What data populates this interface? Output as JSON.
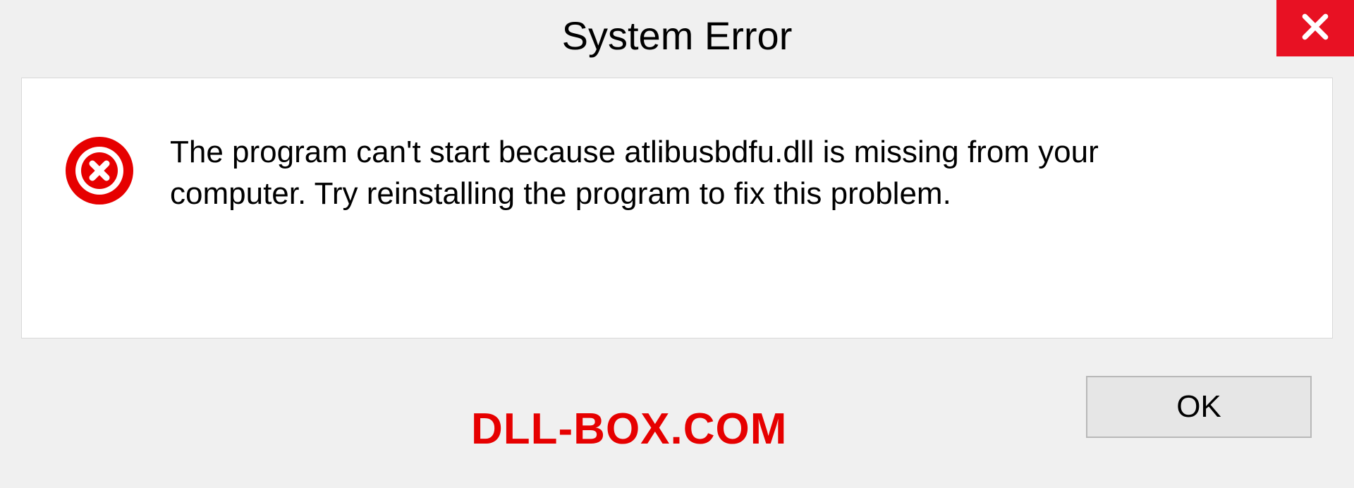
{
  "titlebar": {
    "title": "System Error"
  },
  "dialog": {
    "message": "The program can't start because atlibusbdfu.dll is missing from your computer. Try reinstalling the program to fix this problem."
  },
  "footer": {
    "watermark": "DLL-BOX.COM",
    "ok_label": "OK"
  },
  "colors": {
    "close_bg": "#e81123",
    "error_icon": "#e60000",
    "watermark": "#e60000",
    "panel_bg": "#ffffff",
    "body_bg": "#f0f0f0"
  }
}
